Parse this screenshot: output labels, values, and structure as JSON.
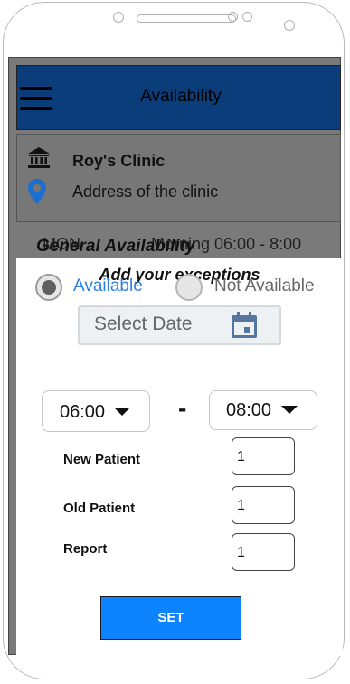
{
  "header": {
    "title": "Availability",
    "menu_icon": "hamburger-menu-icon"
  },
  "clinic": {
    "name": "Roy's Clinic",
    "address": "Address of the clinic",
    "name_icon": "bank-building-icon",
    "address_icon": "map-pin-icon"
  },
  "general_availability": {
    "title": "General Availability",
    "day": "MON",
    "slot": "Morning 06:00 - 8:00"
  },
  "exceptions": {
    "title": "Add your exceptions",
    "available_label": "Available",
    "not_available_label": "Not Available",
    "selected_option": "Available",
    "date_placeholder": "Select Date",
    "time_start": "06:00",
    "time_end": "08:00",
    "time_separator": "-",
    "new_patient_label": "New Patient",
    "new_patient_value": "1",
    "old_patient_label": "Old Patient",
    "old_patient_value": "1",
    "report_label": "Report",
    "report_value": "1",
    "set_label": "SET"
  },
  "colors": {
    "header": "#0a3d7a",
    "available_text": "#2f7fe0",
    "set_button": "#0d84ff",
    "screen_overlay": "#7a7a7a"
  }
}
